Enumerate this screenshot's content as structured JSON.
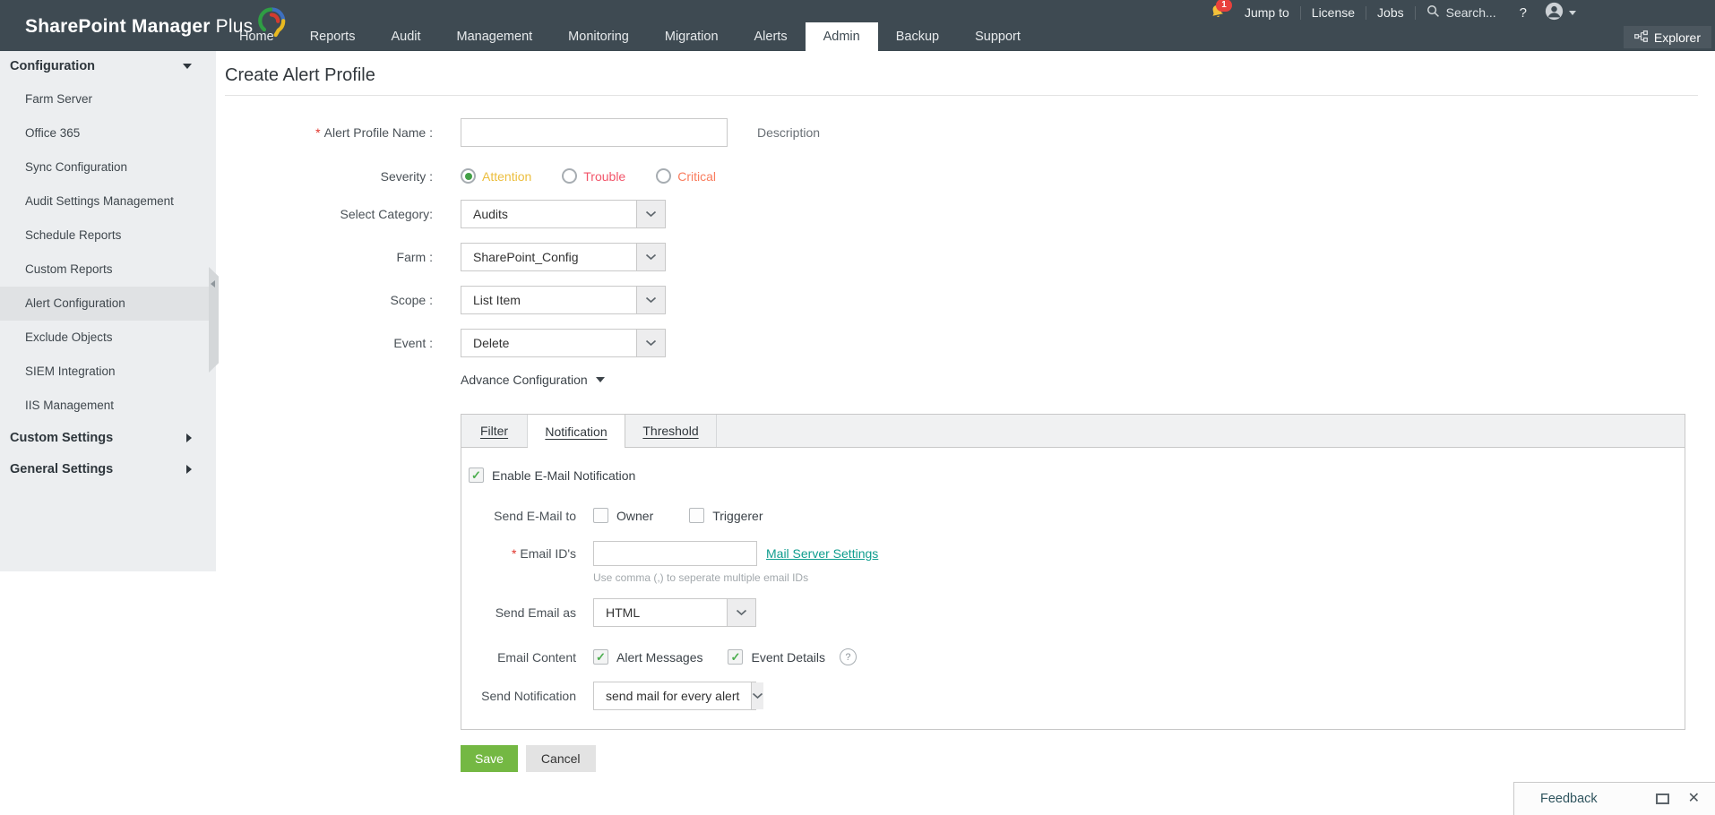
{
  "header": {
    "product_bold": "SharePoint Manager",
    "product_light": "Plus",
    "nav": [
      {
        "label": "Home",
        "active": false
      },
      {
        "label": "Reports",
        "active": false
      },
      {
        "label": "Audit",
        "active": false
      },
      {
        "label": "Management",
        "active": false
      },
      {
        "label": "Monitoring",
        "active": false
      },
      {
        "label": "Migration",
        "active": false
      },
      {
        "label": "Alerts",
        "active": false
      },
      {
        "label": "Admin",
        "active": true
      },
      {
        "label": "Backup",
        "active": false
      },
      {
        "label": "Support",
        "active": false
      }
    ],
    "utility": {
      "bell_badge": "1",
      "jump_to": "Jump to",
      "license": "License",
      "jobs": "Jobs",
      "search": "Search...",
      "help": "?",
      "explorer": "Explorer"
    }
  },
  "sidebar": {
    "configuration_label": "Configuration",
    "items": [
      "Farm Server",
      "Office 365",
      "Sync Configuration",
      "Audit Settings Management",
      "Schedule Reports",
      "Custom Reports",
      "Alert Configuration",
      "Exclude Objects",
      "SIEM Integration",
      "IIS Management"
    ],
    "active_item": "Alert Configuration",
    "custom_settings_label": "Custom Settings",
    "general_settings_label": "General Settings"
  },
  "main": {
    "title": "Create Alert Profile",
    "form": {
      "name_label": "Alert Profile Name :",
      "description_label": "Description",
      "severity_label": "Severity :",
      "severity": [
        {
          "label": "Attention",
          "color": "#ecbe3d",
          "selected": true
        },
        {
          "label": "Trouble",
          "color": "#f2556a",
          "selected": false
        },
        {
          "label": "Critical",
          "color": "#f97c5d",
          "selected": false
        }
      ],
      "category_label": "Select Category:",
      "category_value": "Audits",
      "farm_label": "Farm :",
      "farm_value": "SharePoint_Config",
      "scope_label": "Scope :",
      "scope_value": "List Item",
      "event_label": "Event :",
      "event_value": "Delete",
      "advance_label": "Advance Configuration"
    },
    "tabs": [
      {
        "label": "Filter",
        "active": false
      },
      {
        "label": "Notification",
        "active": true
      },
      {
        "label": "Threshold",
        "active": false
      }
    ],
    "notification": {
      "enable_label": "Enable E-Mail Notification",
      "enable_checked": true,
      "send_to_label": "Send E-Mail to",
      "owner_label": "Owner",
      "owner_checked": false,
      "triggerer_label": "Triggerer",
      "triggerer_checked": false,
      "email_ids_label": "Email ID's",
      "mail_server_link": "Mail Server Settings",
      "email_hint": "Use comma (,) to seperate multiple email IDs",
      "send_email_as_label": "Send Email as",
      "send_email_as_value": "HTML",
      "email_content_label": "Email Content",
      "alert_messages_label": "Alert Messages",
      "alert_messages_checked": true,
      "event_details_label": "Event Details",
      "event_details_checked": true,
      "help_icon": "?",
      "send_notification_label": "Send Notification",
      "send_notification_value": "send mail for every alert"
    },
    "save_label": "Save",
    "cancel_label": "Cancel"
  },
  "feedback": {
    "label": "Feedback"
  },
  "colors": {
    "header_bg": "#3e4a52",
    "save_green": "#74b843",
    "link_teal": "#0f9d8e",
    "severity_attention": "#ecbe3d",
    "severity_trouble": "#f2556a",
    "severity_critical": "#f97c5d",
    "badge_red": "#e8413c"
  }
}
